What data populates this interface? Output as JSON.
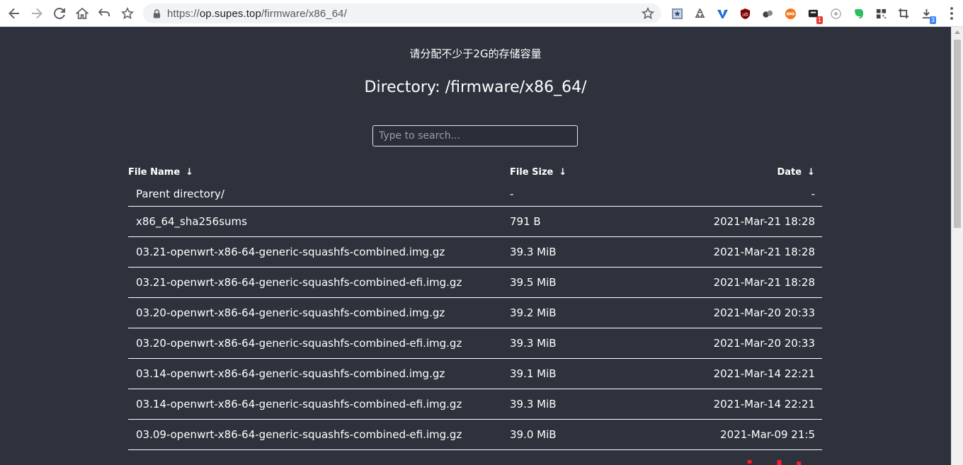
{
  "browser": {
    "url_scheme": "https://",
    "url_host": "op.supes.top",
    "url_path": "/firmware/x86_64/",
    "download_badge": "3",
    "ext_badge": "1"
  },
  "page": {
    "notice": "请分配不少于2G的存储容量",
    "title": "Directory: /firmware/x86_64/",
    "search_placeholder": "Type to search..."
  },
  "table": {
    "headers": {
      "name": "File Name",
      "size": "File Size",
      "date": "Date"
    },
    "rows": [
      {
        "name": "Parent directory/",
        "size": "-",
        "date": "-"
      },
      {
        "name": "x86_64_sha256sums",
        "size": "791 B",
        "date": "2021-Mar-21 18:28"
      },
      {
        "name": "03.21-openwrt-x86-64-generic-squashfs-combined.img.gz",
        "size": "39.3 MiB",
        "date": "2021-Mar-21 18:28"
      },
      {
        "name": "03.21-openwrt-x86-64-generic-squashfs-combined-efi.img.gz",
        "size": "39.5 MiB",
        "date": "2021-Mar-21 18:28"
      },
      {
        "name": "03.20-openwrt-x86-64-generic-squashfs-combined.img.gz",
        "size": "39.2 MiB",
        "date": "2021-Mar-20 20:33"
      },
      {
        "name": "03.20-openwrt-x86-64-generic-squashfs-combined-efi.img.gz",
        "size": "39.3 MiB",
        "date": "2021-Mar-20 20:33"
      },
      {
        "name": "03.14-openwrt-x86-64-generic-squashfs-combined.img.gz",
        "size": "39.1 MiB",
        "date": "2021-Mar-14 22:21"
      },
      {
        "name": "03.14-openwrt-x86-64-generic-squashfs-combined-efi.img.gz",
        "size": "39.3 MiB",
        "date": "2021-Mar-14 22:21"
      },
      {
        "name": "03.09-openwrt-x86-64-generic-squashfs-combined-efi.img.gz",
        "size": "39.0 MiB",
        "date": "2021-Mar-09 21:5"
      }
    ]
  },
  "watermark": "www.right.com.cn",
  "colors": {
    "page_bg": "#2e323d",
    "watermark": "#ff1a2e"
  }
}
